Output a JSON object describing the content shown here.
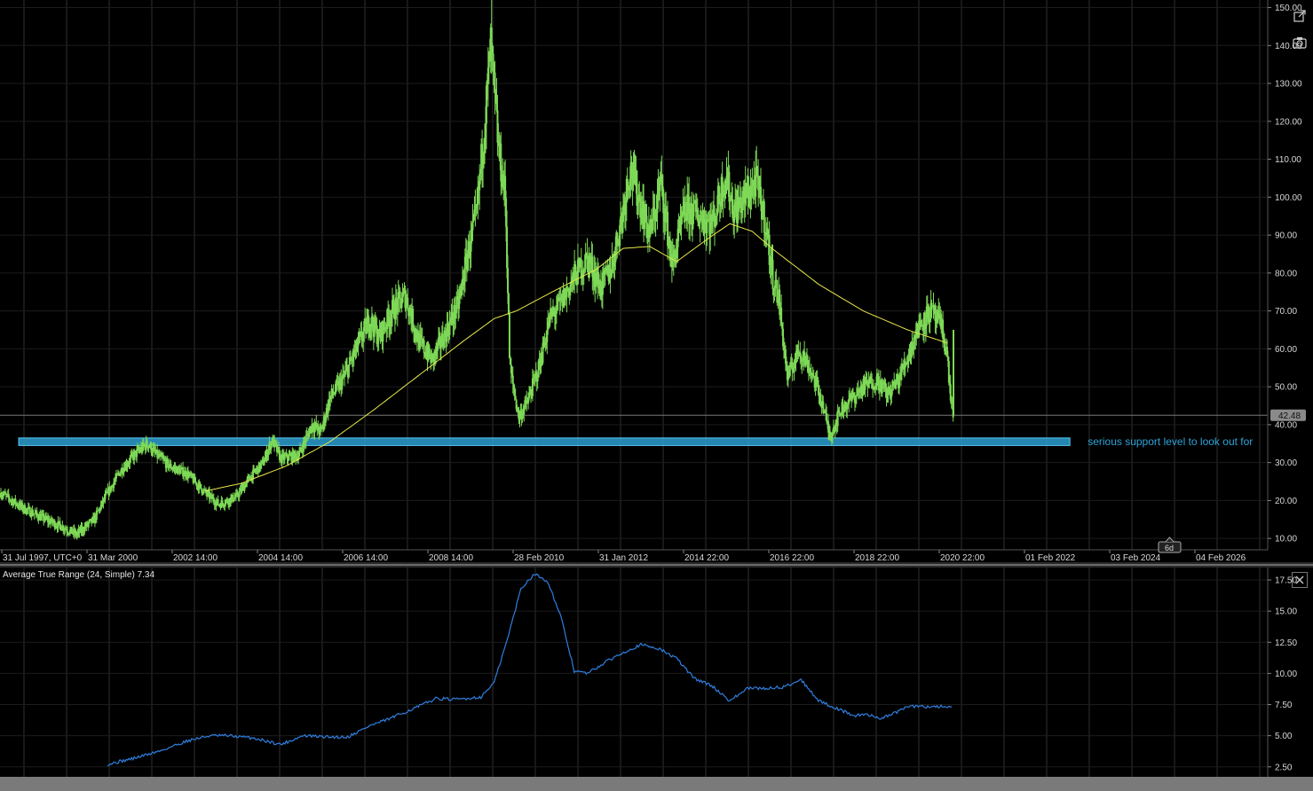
{
  "main_chart": {
    "y_axis": {
      "min": 7,
      "max": 152,
      "ticks": [
        "10.00",
        "20.00",
        "30.00",
        "40.00",
        "50.00",
        "60.00",
        "70.00",
        "80.00",
        "90.00",
        "100.00",
        "110.00",
        "120.00",
        "130.00",
        "140.00",
        "150.00"
      ]
    },
    "x_labels": [
      "31 Jul 1997, UTC+0",
      "31 Mar 2000",
      "2002 14:00",
      "2004 14:00",
      "2006 14:00",
      "2008 14:00",
      "28 Feb 2010",
      "31 Jan 2012",
      "2014 22:00",
      "2016 22:00",
      "2018 22:00",
      "2020 22:00",
      "01 Feb 2022",
      "03 Feb 2024",
      "04 Feb 2026"
    ],
    "current_price_label": "42.48",
    "current_price": 42.48,
    "annotation": "serious support level to look out for",
    "support_zone": {
      "low": 34.5,
      "high": 36.5
    },
    "future_marker": "6d",
    "colors": {
      "candles": "#7ed957",
      "moving_average": "#e8e84a",
      "support_zone": "#2b9fd0",
      "grid": "#3a3a3a",
      "price_line": "#777777"
    }
  },
  "indicator": {
    "label": "Average True Range (24, Simple) 7.34",
    "y_axis": {
      "min": 1.7,
      "max": 18.5,
      "ticks": [
        "2.50",
        "5.00",
        "7.50",
        "10.00",
        "12.50",
        "15.00",
        "17.50"
      ]
    },
    "color": "#2f7fe0"
  },
  "icons": {
    "popout": "external-link-icon",
    "screenshot": "camera-icon",
    "close": "close-icon"
  },
  "chart_data": [
    {
      "type": "candlestick",
      "title": "",
      "xlabel": "",
      "ylabel": "",
      "ylim": [
        7,
        152
      ],
      "grid": true,
      "x_range": [
        1997.58,
        2026.1
      ],
      "price_anchors": [
        [
          1997.6,
          22
        ],
        [
          1998.1,
          18
        ],
        [
          1998.6,
          15
        ],
        [
          1999.0,
          13
        ],
        [
          1999.3,
          11
        ],
        [
          1999.7,
          15
        ],
        [
          2000.0,
          22
        ],
        [
          2000.3,
          28
        ],
        [
          2000.6,
          32
        ],
        [
          2000.9,
          35
        ],
        [
          2001.1,
          32
        ],
        [
          2001.4,
          29
        ],
        [
          2001.8,
          27
        ],
        [
          2002.2,
          22
        ],
        [
          2002.5,
          19
        ],
        [
          2002.9,
          21
        ],
        [
          2003.2,
          26
        ],
        [
          2003.5,
          30
        ],
        [
          2003.7,
          36
        ],
        [
          2003.9,
          31
        ],
        [
          2004.3,
          32
        ],
        [
          2004.6,
          40
        ],
        [
          2004.8,
          38
        ],
        [
          2005.0,
          47
        ],
        [
          2005.3,
          52
        ],
        [
          2005.6,
          60
        ],
        [
          2005.9,
          68
        ],
        [
          2006.1,
          63
        ],
        [
          2006.4,
          70
        ],
        [
          2006.7,
          74
        ],
        [
          2007.0,
          62
        ],
        [
          2007.3,
          57
        ],
        [
          2007.6,
          64
        ],
        [
          2007.9,
          72
        ],
        [
          2008.1,
          85
        ],
        [
          2008.3,
          95
        ],
        [
          2008.5,
          122
        ],
        [
          2008.62,
          140
        ],
        [
          2008.8,
          112
        ],
        [
          2008.95,
          100
        ],
        [
          2009.05,
          55
        ],
        [
          2009.25,
          42
        ],
        [
          2009.45,
          46
        ],
        [
          2009.7,
          55
        ],
        [
          2009.95,
          68
        ],
        [
          2010.2,
          72
        ],
        [
          2010.5,
          79
        ],
        [
          2010.8,
          84
        ],
        [
          2011.1,
          76
        ],
        [
          2011.35,
          82
        ],
        [
          2011.6,
          97
        ],
        [
          2011.75,
          108
        ],
        [
          2011.95,
          100
        ],
        [
          2012.2,
          90
        ],
        [
          2012.45,
          104
        ],
        [
          2012.7,
          82
        ],
        [
          2013.0,
          97
        ],
        [
          2013.3,
          95
        ],
        [
          2013.6,
          93
        ],
        [
          2013.9,
          106
        ],
        [
          2014.1,
          96
        ],
        [
          2014.4,
          101
        ],
        [
          2014.6,
          104
        ],
        [
          2014.8,
          93
        ],
        [
          2014.95,
          80
        ],
        [
          2015.1,
          73
        ],
        [
          2015.3,
          52
        ],
        [
          2015.55,
          60
        ],
        [
          2015.8,
          55
        ],
        [
          2016.05,
          47
        ],
        [
          2016.25,
          37
        ],
        [
          2016.5,
          44
        ],
        [
          2016.75,
          47
        ],
        [
          2017.0,
          50
        ],
        [
          2017.3,
          52
        ],
        [
          2017.55,
          48
        ],
        [
          2017.8,
          52
        ],
        [
          2018.0,
          58
        ],
        [
          2018.25,
          66
        ],
        [
          2018.5,
          70
        ],
        [
          2018.75,
          66
        ],
        [
          2018.87,
          60
        ],
        [
          2018.97,
          47
        ],
        [
          2019.03,
          42.5
        ]
      ],
      "moving_average_anchors": [
        [
          2002.2,
          22.5
        ],
        [
          2003.0,
          24.5
        ],
        [
          2004.0,
          29
        ],
        [
          2005.0,
          35.5
        ],
        [
          2006.0,
          44
        ],
        [
          2007.0,
          53
        ],
        [
          2008.0,
          62
        ],
        [
          2008.7,
          68
        ],
        [
          2009.2,
          70
        ],
        [
          2010.0,
          75
        ],
        [
          2011.0,
          81
        ],
        [
          2011.6,
          86.5
        ],
        [
          2012.2,
          87
        ],
        [
          2012.8,
          83
        ],
        [
          2013.5,
          89
        ],
        [
          2014.0,
          93
        ],
        [
          2014.5,
          91
        ],
        [
          2015.0,
          86
        ],
        [
          2016.0,
          77
        ],
        [
          2017.0,
          70
        ],
        [
          2018.0,
          65
        ],
        [
          2018.9,
          61.5
        ]
      ],
      "series": [
        {
          "name": "",
          "values": []
        }
      ]
    },
    {
      "type": "line",
      "title": "Average True Range (24, Simple) 7.34",
      "xlabel": "",
      "ylabel": "",
      "ylim": [
        1.7,
        18.5
      ],
      "x": [
        2000.0,
        2000.6,
        2001.2,
        2001.8,
        2002.3,
        2002.7,
        2003.3,
        2003.9,
        2004.4,
        2004.9,
        2005.4,
        2005.9,
        2006.3,
        2006.9,
        2007.4,
        2007.8,
        2008.1,
        2008.4,
        2008.7,
        2009.0,
        2009.3,
        2009.6,
        2009.9,
        2010.2,
        2010.5,
        2010.8,
        2011.2,
        2011.6,
        2012.0,
        2012.4,
        2012.8,
        2013.2,
        2013.6,
        2014.0,
        2014.4,
        2014.8,
        2015.2,
        2015.6,
        2016.0,
        2016.4,
        2016.8,
        2017.1,
        2017.4,
        2017.7,
        2018.0,
        2018.3,
        2018.6,
        2018.85,
        2019.0
      ],
      "y": [
        2.7,
        3.2,
        3.8,
        4.6,
        5.0,
        5.0,
        4.8,
        4.3,
        5.0,
        4.9,
        4.9,
        5.8,
        6.3,
        7.2,
        8.0,
        7.9,
        8.0,
        8.1,
        9.3,
        12.8,
        16.8,
        18.0,
        17.4,
        14.5,
        10.2,
        10.0,
        10.9,
        11.7,
        12.3,
        12.0,
        11.2,
        9.6,
        9.0,
        7.8,
        8.8,
        8.8,
        8.9,
        9.5,
        7.8,
        7.2,
        6.6,
        6.7,
        6.4,
        6.8,
        7.34,
        7.34,
        7.34,
        7.34,
        7.34
      ],
      "series": [
        {
          "name": "",
          "values": []
        }
      ]
    }
  ]
}
